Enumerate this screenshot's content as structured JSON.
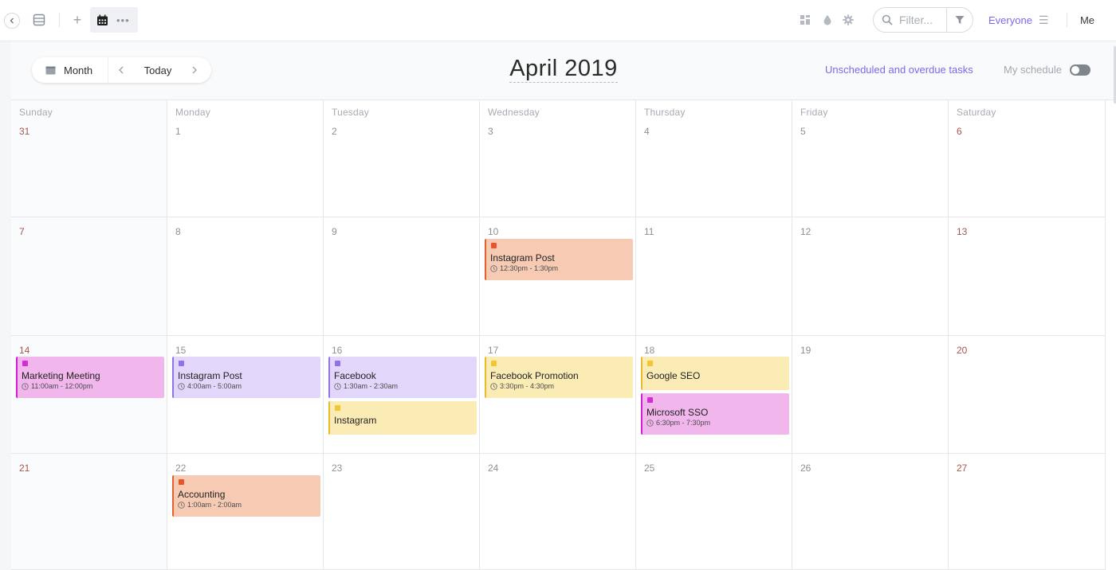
{
  "toolbar": {
    "filter_placeholder": "Filter...",
    "everyone_label": "Everyone",
    "me_label": "Me"
  },
  "header": {
    "view_label": "Month",
    "today_label": "Today",
    "title": "April 2019",
    "unscheduled_label": "Unscheduled and overdue tasks",
    "my_schedule_label": "My schedule"
  },
  "weekdays": [
    "Sunday",
    "Monday",
    "Tuesday",
    "Wednesday",
    "Thursday",
    "Friday",
    "Saturday"
  ],
  "weeks": [
    [
      "31",
      "1",
      "2",
      "3",
      "4",
      "5",
      "6"
    ],
    [
      "7",
      "8",
      "9",
      "10",
      "11",
      "12",
      "13"
    ],
    [
      "14",
      "15",
      "16",
      "17",
      "18",
      "19",
      "20"
    ],
    [
      "21",
      "22",
      "23",
      "24",
      "25",
      "26",
      "27"
    ]
  ],
  "colors": {
    "accent": "#7b68ee",
    "orange": {
      "bg": "#f7cbb3",
      "border": "#e1622b",
      "square": "#e8542a"
    },
    "magenta": {
      "bg": "#f1b6ec",
      "border": "#d21fd1",
      "square": "#d42dd4"
    },
    "lavender": {
      "bg": "#e2d7fb",
      "border": "#8e74e8",
      "square": "#8e72ea"
    },
    "yellow": {
      "bg": "#fbecb6",
      "border": "#e6bb2c",
      "square": "#f1c631"
    }
  },
  "events": [
    {
      "week": 1,
      "day": 3,
      "slot": 0,
      "title": "Instagram Post",
      "time": "12:30pm - 1:30pm",
      "color": "orange"
    },
    {
      "week": 2,
      "day": 0,
      "slot": 0,
      "title": "Marketing Meeting",
      "time": "11:00am - 12:00pm",
      "color": "magenta"
    },
    {
      "week": 2,
      "day": 1,
      "slot": 0,
      "title": "Instagram Post",
      "time": "4:00am - 5:00am",
      "color": "lavender"
    },
    {
      "week": 2,
      "day": 2,
      "slot": 0,
      "title": "Facebook",
      "time": "1:30am - 2:30am",
      "color": "lavender"
    },
    {
      "week": 2,
      "day": 2,
      "slot": 1,
      "title": "Instagram",
      "time": "",
      "color": "yellow"
    },
    {
      "week": 2,
      "day": 3,
      "slot": 0,
      "title": "Facebook Promotion",
      "time": "3:30pm - 4:30pm",
      "color": "yellow"
    },
    {
      "week": 2,
      "day": 4,
      "slot": 0,
      "title": "Google SEO",
      "time": "",
      "color": "yellow"
    },
    {
      "week": 2,
      "day": 4,
      "slot": 1,
      "title": "Microsoft SSO",
      "time": "6:30pm - 7:30pm",
      "color": "magenta"
    },
    {
      "week": 3,
      "day": 1,
      "slot": 0,
      "title": "Accounting",
      "time": "1:00am - 2:00am",
      "color": "orange"
    }
  ]
}
